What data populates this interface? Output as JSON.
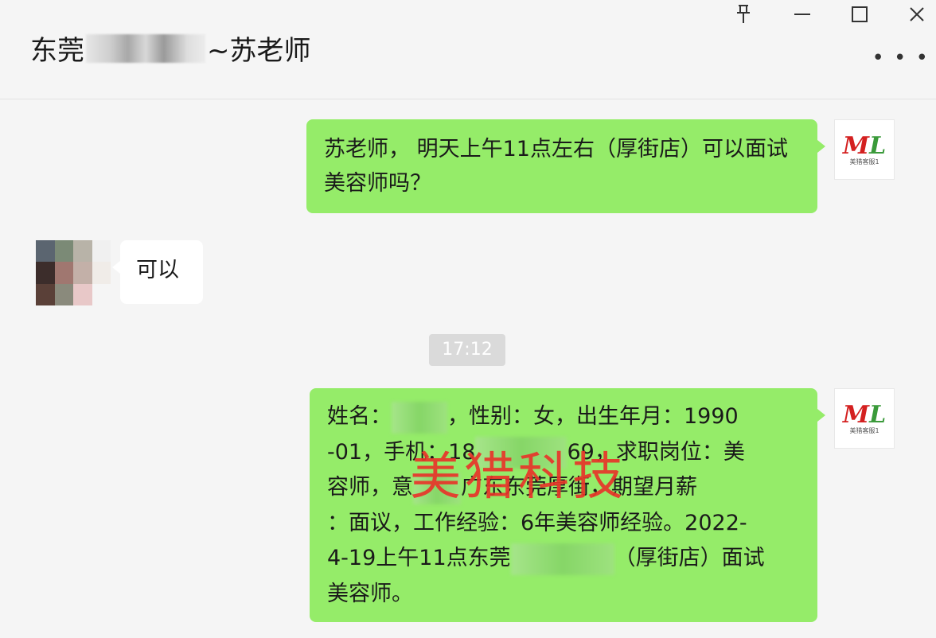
{
  "window": {
    "title_prefix": "东莞",
    "title_suffix": "~苏老师",
    "pin_icon": "pin-icon",
    "minimize_icon": "minimize-icon",
    "maximize_icon": "maximize-icon",
    "close_icon": "close-icon",
    "more_icon": "more-icon"
  },
  "messages": [
    {
      "sender": "me",
      "text": "苏老师， 明天上午11点左右（厚街店）可以面试美容师吗？"
    },
    {
      "sender": "other",
      "text": "可以"
    },
    {
      "sender": "me",
      "text_lines": [
        "姓名：",
        "，性别：女，出生年月：1990",
        "-01，手机：18",
        "69，求职岗位：美",
        "容师，意",
        "广东东莞厚街，期望月薪",
        "：面议，工作经验：6年美容师经验。2022-",
        "4-19上午11点东莞",
        "（厚街店）面试",
        "美容师。"
      ]
    }
  ],
  "timestamp": "17:12",
  "watermark": "美猎科技",
  "avatar_logo": {
    "text": "ML",
    "sub": "美猎客服1"
  },
  "colors": {
    "me_bubble": "#95ec69",
    "other_bubble": "#ffffff",
    "watermark": "#e8352a"
  }
}
